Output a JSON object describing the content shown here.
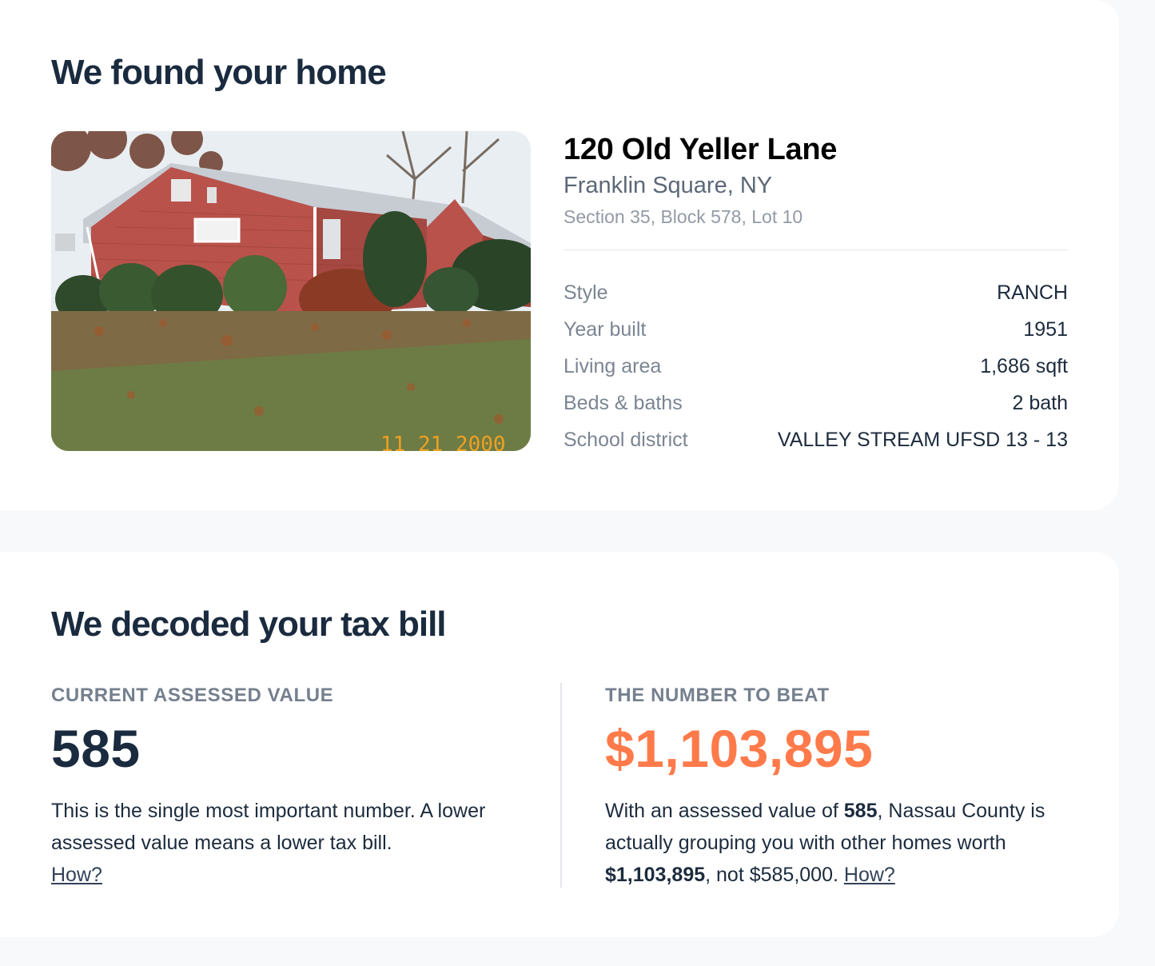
{
  "home_section": {
    "title": "We found your home",
    "photo_alt": "house-photo",
    "photo_datestamp": "11 21 2000",
    "address": "120 Old Yeller Lane",
    "city": "Franklin Square, NY",
    "parcel": "Section 35, Block 578, Lot 10",
    "facts": [
      {
        "label": "Style",
        "value": "RANCH"
      },
      {
        "label": "Year built",
        "value": "1951"
      },
      {
        "label": "Living area",
        "value": "1,686 sqft"
      },
      {
        "label": "Beds & baths",
        "value": "2 bath"
      },
      {
        "label": "School district",
        "value": "VALLEY STREAM UFSD 13 - 13"
      }
    ]
  },
  "tax_section": {
    "title": "We decoded your tax bill",
    "left": {
      "eyebrow": "CURRENT ASSESSED VALUE",
      "value": "585",
      "text": "This is the single most important number. A lower assessed value means a lower tax bill.",
      "link": "How?"
    },
    "right": {
      "eyebrow": "THE NUMBER TO BEAT",
      "value": "$1,103,895",
      "text_1": "With an assessed value of ",
      "text_bold_1": "585",
      "text_2": ", Nassau County is actually grouping you with other homes worth ",
      "text_bold_2": "$1,103,895",
      "text_3": ", not $585,000. ",
      "link": "How?"
    }
  },
  "colors": {
    "heading": "#1a2b3f",
    "accent": "#ff7a4a",
    "muted": "#7b8593"
  }
}
